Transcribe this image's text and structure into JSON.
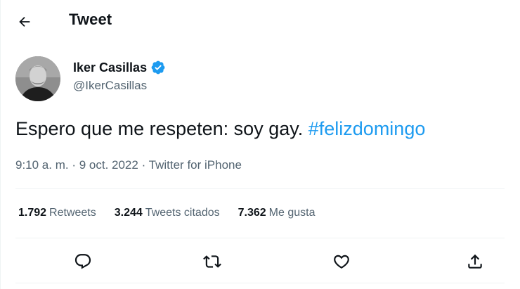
{
  "header": {
    "title": "Tweet",
    "back_icon": "arrow-left-icon"
  },
  "author": {
    "name": "Iker Casillas",
    "handle": "@IkerCasillas",
    "verified_color": "#1d9bf0"
  },
  "tweet": {
    "text": "Espero que me respeten: soy gay.",
    "hashtag": "#felizdomingo",
    "hashtag_color": "#1d9bf0"
  },
  "meta": {
    "time": "9:10 a. m.",
    "separator": " · ",
    "date": "9 oct. 2022",
    "source": "Twitter for iPhone"
  },
  "stats": {
    "retweets_count": "1.792",
    "retweets_label": "Retweets",
    "quotes_count": "3.244",
    "quotes_label": "Tweets citados",
    "likes_count": "7.362",
    "likes_label": "Me gusta"
  },
  "actions": {
    "reply_icon": "reply-icon",
    "retweet_icon": "retweet-icon",
    "like_icon": "heart-icon",
    "share_icon": "share-icon"
  }
}
